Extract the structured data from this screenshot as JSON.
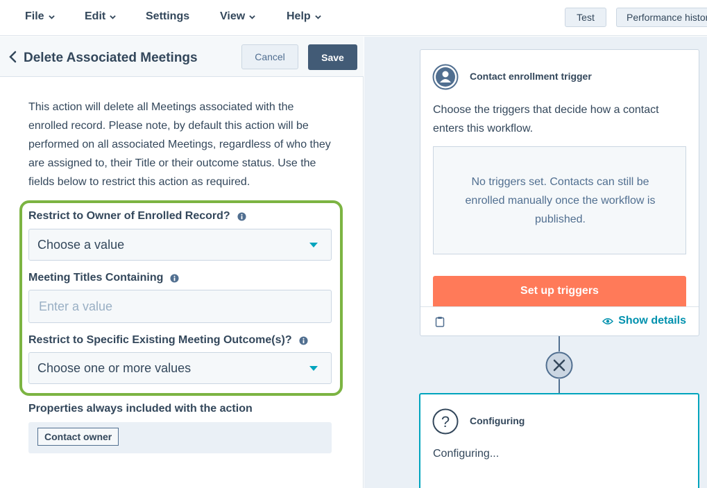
{
  "menu": {
    "file": "File",
    "edit": "Edit",
    "settings": "Settings",
    "view": "View",
    "help": "Help",
    "test": "Test",
    "performance": "Performance history"
  },
  "panel": {
    "title": "Delete Associated Meetings",
    "cancel": "Cancel",
    "save": "Save",
    "description": "This action will delete all Meetings associated with the enrolled record. Please note, by default this action will be performed on all associated Meetings, regardless of who they are assigned to, their Title or their outcome status. Use the fields below to restrict this action as required.",
    "fields": {
      "owner_label": "Restrict to Owner of Enrolled Record?",
      "owner_value": "Choose a value",
      "titles_label": "Meeting Titles Containing",
      "titles_placeholder": "Enter a value",
      "outcome_label": "Restrict to Specific Existing Meeting Outcome(s)?",
      "outcome_value": "Choose one or more values"
    },
    "properties_label": "Properties always included with the action",
    "properties_chip": "Contact owner"
  },
  "canvas": {
    "trigger_card": {
      "title": "Contact enrollment trigger",
      "text": "Choose the triggers that decide how a contact enters this workflow.",
      "empty_text": "No triggers set. Contacts can still be enrolled manually once the workflow is published.",
      "setup_button": "Set up triggers",
      "show_details": "Show details"
    },
    "config_card": {
      "title": "Configuring",
      "text": "Configuring..."
    }
  },
  "colors": {
    "primary_text": "#33475b",
    "accent_green": "#7cb442",
    "setup_orange": "#ff7a59",
    "link_teal": "#0091ae",
    "active_border": "#00a4bd"
  }
}
